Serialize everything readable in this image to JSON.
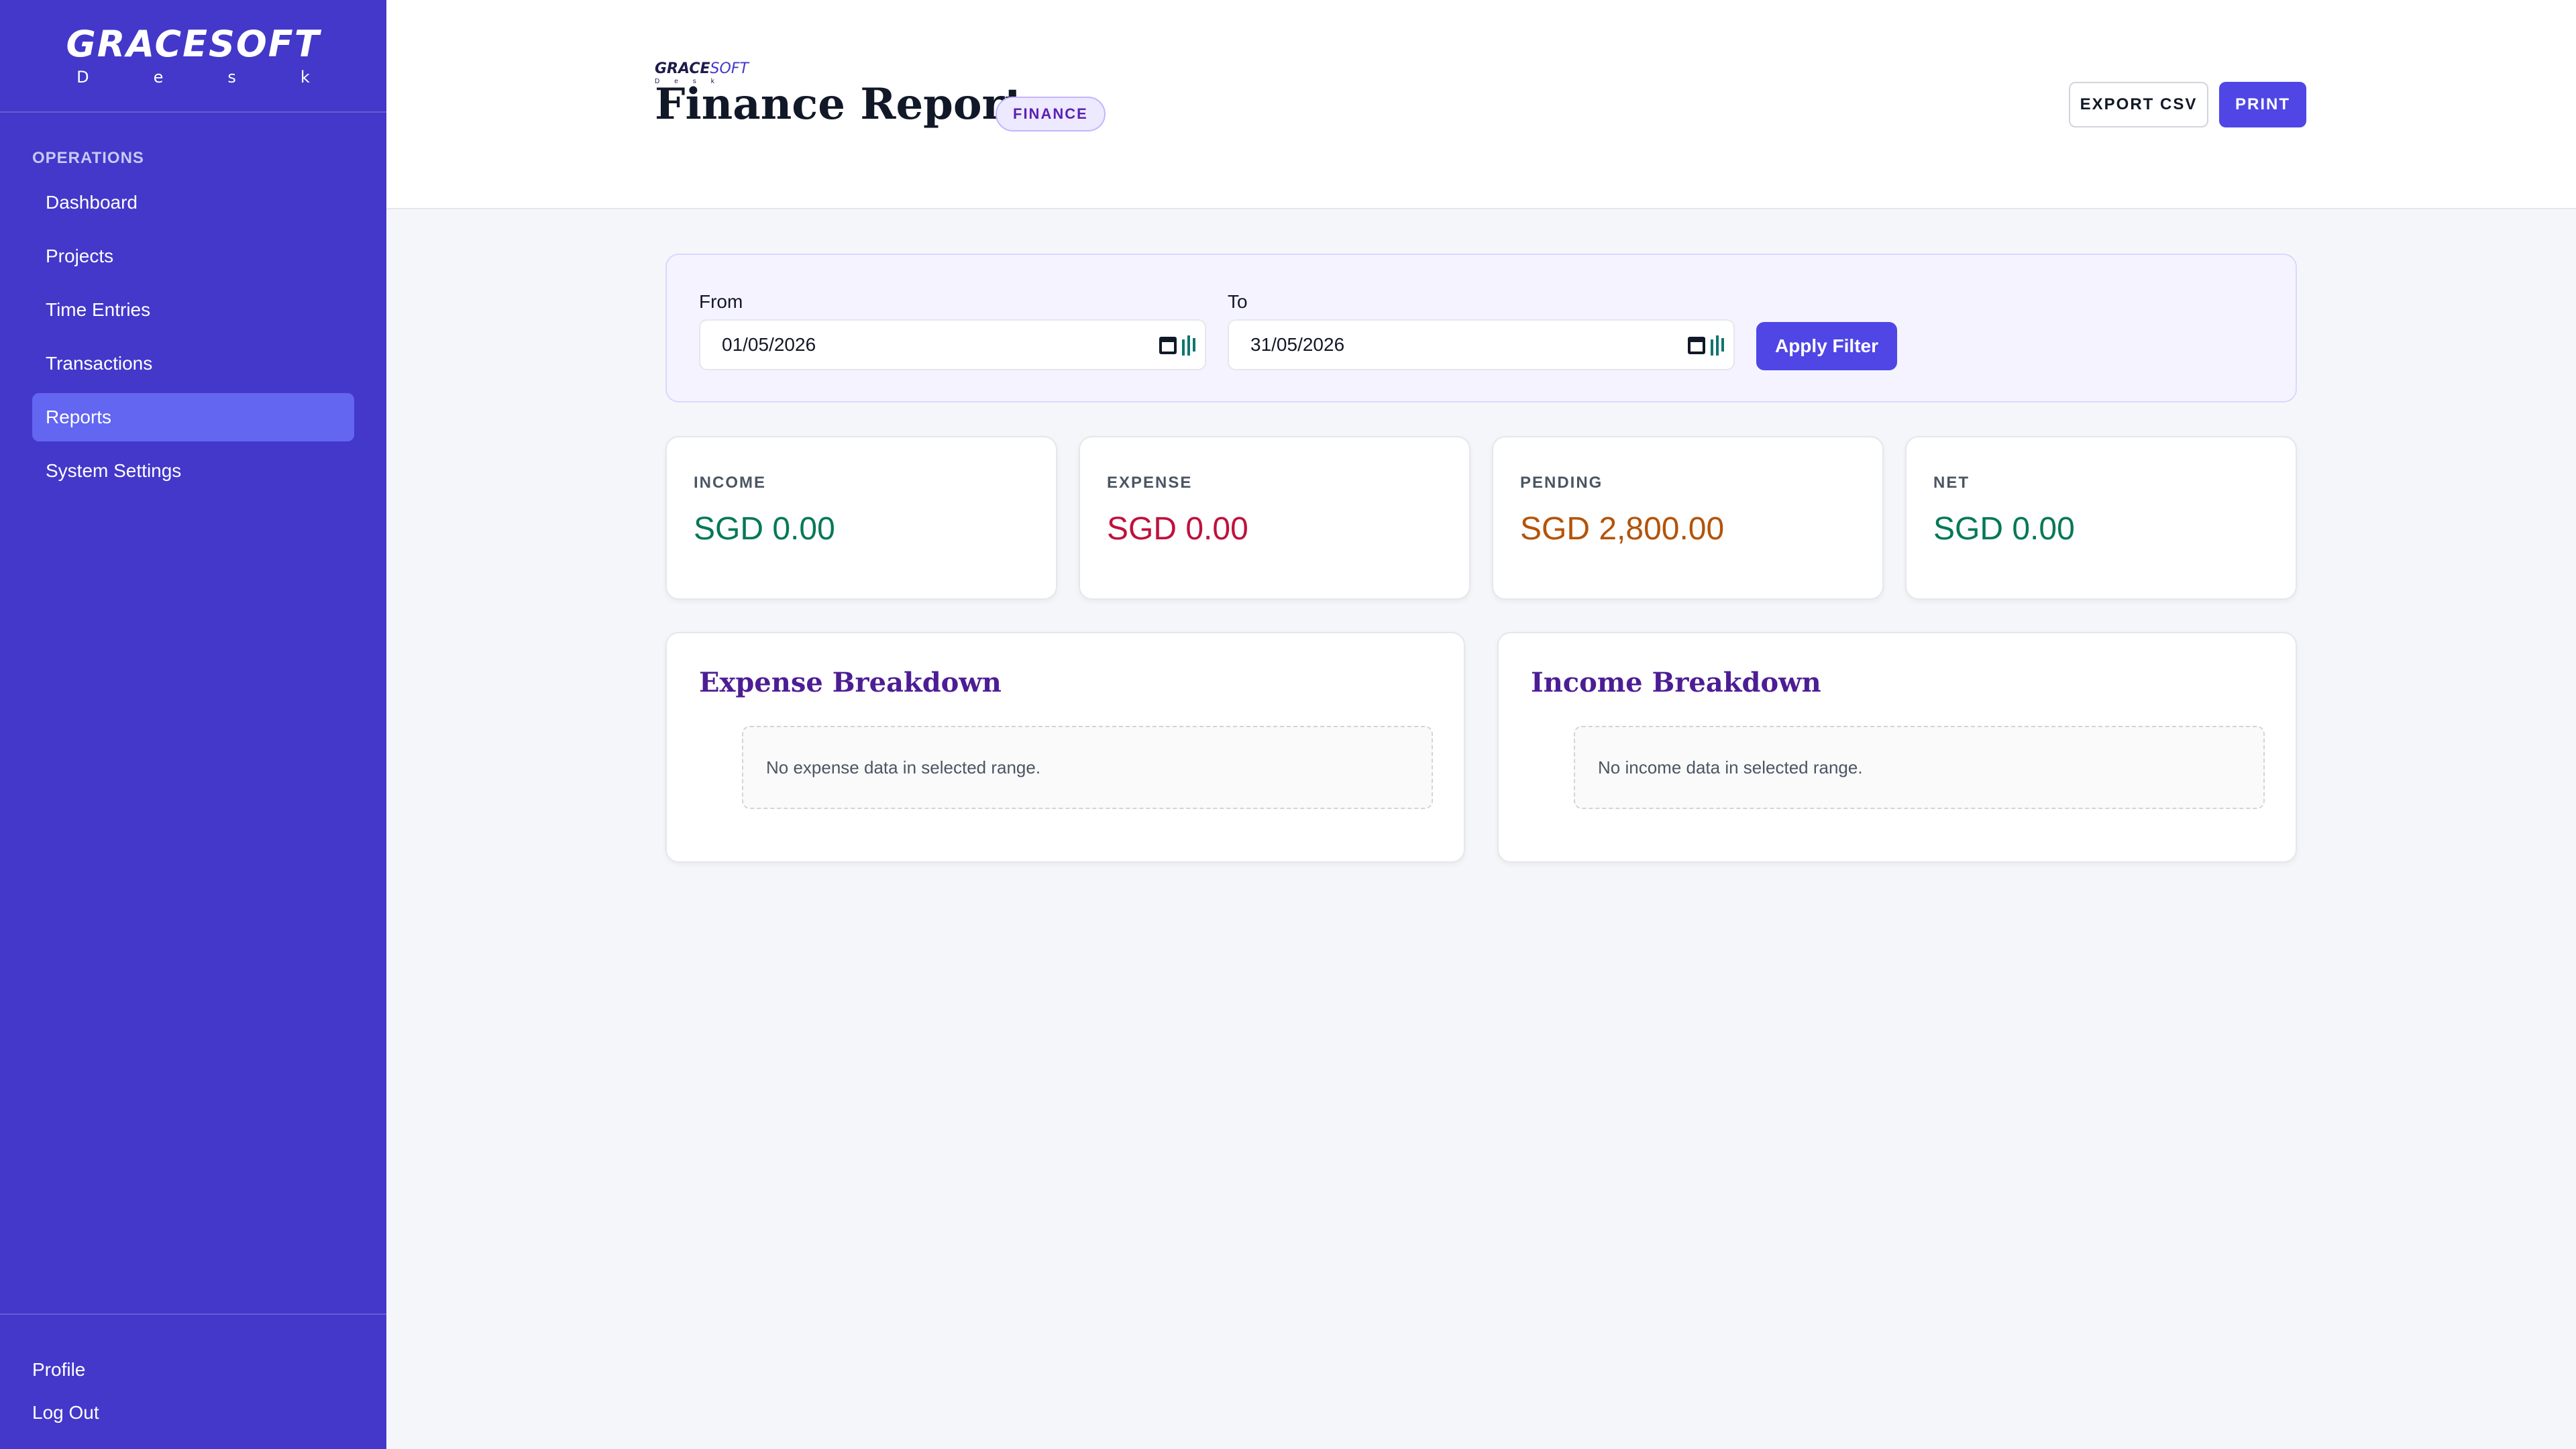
{
  "sidebar": {
    "brand_main": "GRACESOFT",
    "brand_sub": "Desk",
    "section": "OPERATIONS",
    "items": [
      {
        "label": "Dashboard"
      },
      {
        "label": "Projects"
      },
      {
        "label": "Time Entries"
      },
      {
        "label": "Transactions"
      },
      {
        "label": "Reports",
        "active": true
      },
      {
        "label": "System Settings"
      }
    ],
    "profile": "Profile",
    "logout": "Log Out"
  },
  "header": {
    "logo_grace": "GRACE",
    "logo_soft": "SOFT",
    "logo_sub": "Desk",
    "title": "Finance Report",
    "badge": "FINANCE",
    "export_label": "EXPORT CSV",
    "print_label": "PRINT"
  },
  "filter": {
    "from_label": "From",
    "from_value": "01/05/2026",
    "to_label": "To",
    "to_value": "31/05/2026",
    "apply_label": "Apply Filter"
  },
  "stats": [
    {
      "label": "INCOME",
      "value": "SGD 0.00",
      "color": "#047857"
    },
    {
      "label": "EXPENSE",
      "value": "SGD 0.00",
      "color": "#be123c"
    },
    {
      "label": "PENDING",
      "value": "SGD 2,800.00",
      "color": "#b45309"
    },
    {
      "label": "NET",
      "value": "SGD 0.00",
      "color": "#047857"
    }
  ],
  "breakdown": {
    "expense_title": "Expense Breakdown",
    "expense_empty": "No expense data in selected range.",
    "income_title": "Income Breakdown",
    "income_empty": "No income data in selected range."
  },
  "colors": {
    "sidebar": "#4338ca",
    "accent": "#4f46e5",
    "active_item": "#6366f1"
  }
}
